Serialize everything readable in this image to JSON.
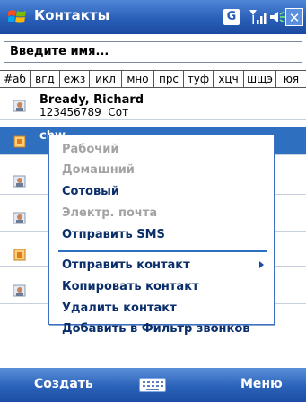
{
  "titlebar": {
    "title": "Контакты",
    "g_badge": "G",
    "close_label": "✕"
  },
  "search": {
    "placeholder": "Введите имя..."
  },
  "alpha_tabs": [
    "#аб",
    "вгд",
    "ежз",
    "икл",
    "мно",
    "прс",
    "туф",
    "хцч",
    "шщэ",
    "юя"
  ],
  "contacts": [
    {
      "name": "Bready, Richard",
      "number": "123456789",
      "type": "Сот"
    },
    {
      "name": "chw"
    }
  ],
  "context_menu": {
    "items": [
      {
        "label": "Рабочий",
        "disabled": true
      },
      {
        "label": "Домашний",
        "disabled": true
      },
      {
        "label": "Сотовый",
        "disabled": false
      },
      {
        "label": "Электр. почта",
        "disabled": true
      },
      {
        "label": "Отправить SMS",
        "disabled": false
      },
      {
        "label": "Отправить контакт",
        "disabled": false,
        "submenu": true
      },
      {
        "label": "Копировать контакт",
        "disabled": false
      },
      {
        "label": "Удалить контакт",
        "disabled": false
      },
      {
        "label": "Добавить в Фильтр звонков",
        "disabled": false
      }
    ]
  },
  "bottombar": {
    "left_softkey": "Создать",
    "right_softkey": "Меню"
  },
  "colors": {
    "accent": "#2f6fc0",
    "bar_blue": "#2a5fb8",
    "disabled_text": "#a3a3a3"
  }
}
